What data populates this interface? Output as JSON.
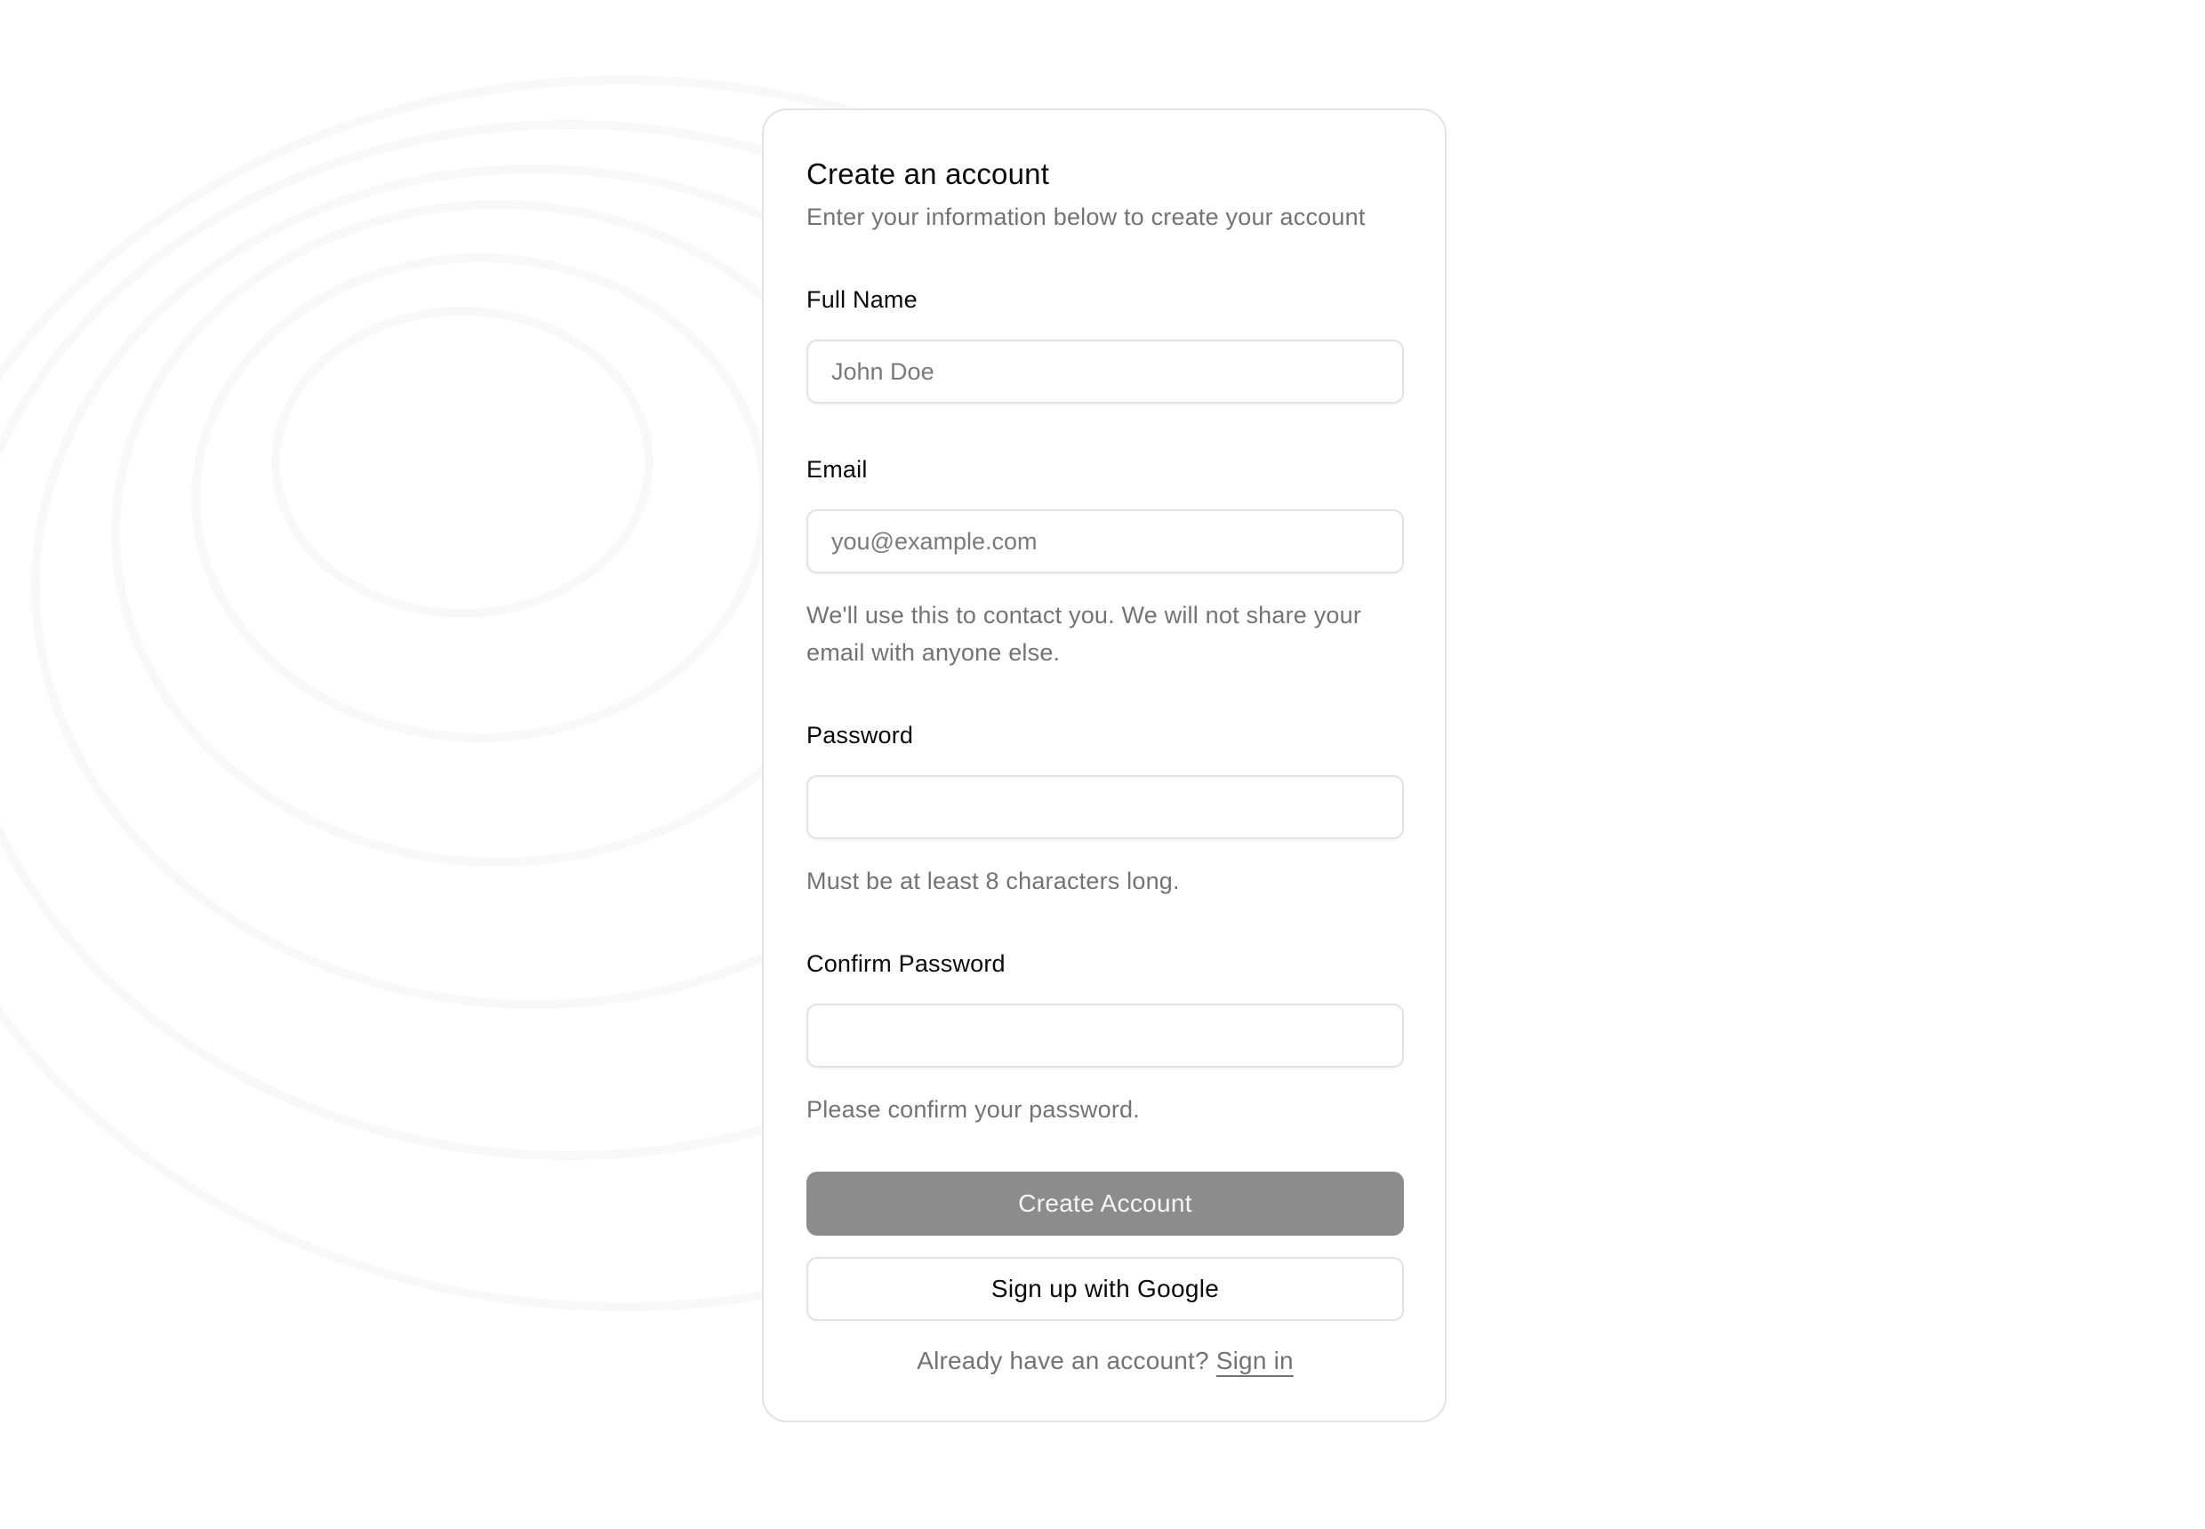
{
  "card": {
    "title": "Create an account",
    "subtitle": "Enter your information below to create your account"
  },
  "fields": {
    "full_name": {
      "label": "Full Name",
      "placeholder": "John Doe",
      "value": ""
    },
    "email": {
      "label": "Email",
      "placeholder": "you@example.com",
      "value": "",
      "helper": "We'll use this to contact you. We will not share your email with anyone else."
    },
    "password": {
      "label": "Password",
      "placeholder": "",
      "value": "",
      "helper": "Must be at least 8 characters long."
    },
    "confirm_password": {
      "label": "Confirm Password",
      "placeholder": "",
      "value": "",
      "helper": "Please confirm your password."
    }
  },
  "actions": {
    "create_account_label": "Create Account",
    "google_label": "Sign up with Google"
  },
  "footer": {
    "prompt": "Already have an account?",
    "sign_in_label": "Sign in"
  },
  "colors": {
    "primary_button_bg": "#8c8c8c",
    "muted_text": "#737373",
    "border": "#e2e2e2"
  }
}
